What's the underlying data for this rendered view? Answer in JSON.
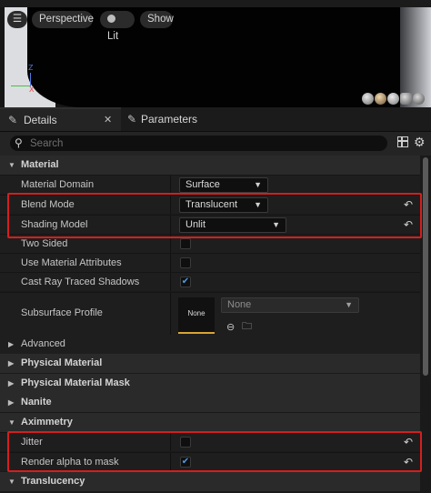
{
  "viewport": {
    "menu_icon": "hamburger-icon",
    "perspective_label": "Perspective",
    "lit_label": "Lit",
    "show_label": "Show",
    "axis_z": "Z",
    "axis_x": "X"
  },
  "tabs": [
    {
      "label": "Details",
      "icon": "details-icon",
      "close": "✕"
    },
    {
      "label": "Parameters",
      "icon": "parameters-icon"
    }
  ],
  "search": {
    "placeholder": "Search"
  },
  "details": {
    "material_category": "Material",
    "material_domain": {
      "label": "Material Domain",
      "value": "Surface"
    },
    "blend_mode": {
      "label": "Blend Mode",
      "value": "Translucent"
    },
    "shading_model": {
      "label": "Shading Model",
      "value": "Unlit"
    },
    "two_sided": {
      "label": "Two Sided",
      "checked": false
    },
    "use_material_attributes": {
      "label": "Use Material Attributes",
      "checked": false
    },
    "cast_ray_traced_shadows": {
      "label": "Cast Ray Traced Shadows",
      "checked": true
    },
    "subsurface_profile": {
      "label": "Subsurface Profile",
      "thumbnail_text": "None",
      "value": "None"
    },
    "advanced_label": "Advanced",
    "physical_material_category": "Physical Material",
    "physical_material_mask_category": "Physical Material Mask",
    "nanite_category": "Nanite",
    "aximmetry_category": "Aximmetry",
    "jitter": {
      "label": "Jitter",
      "checked": false
    },
    "render_alpha_to_mask": {
      "label": "Render alpha to mask",
      "checked": true
    },
    "translucency_category": "Translucency"
  },
  "colors": {
    "highlight": "#d51e1e",
    "check_accent": "#4b9be8",
    "thumbnail_accent": "#d9a436"
  }
}
